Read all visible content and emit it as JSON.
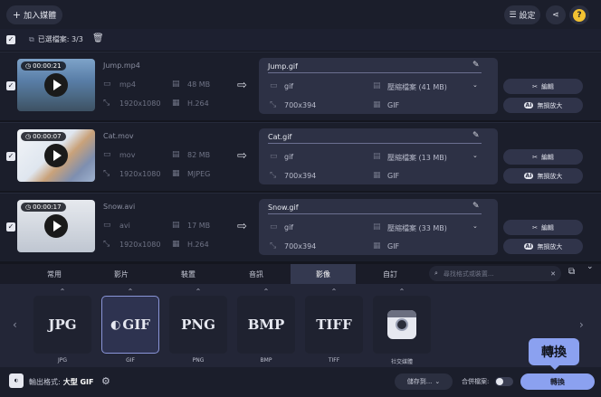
{
  "topbar": {
    "add_media_label": "加入媒體",
    "settings_label": "設定",
    "help_label": "?"
  },
  "selection": {
    "count_label": "已選檔案: 3/3"
  },
  "files": [
    {
      "duration": "00:00:21",
      "source": {
        "name": "Jump.mp4",
        "ext": "mp4",
        "size": "48 MB",
        "resolution": "1920x1080",
        "codec": "H.264"
      },
      "target": {
        "name": "Jump.gif",
        "ext": "gif",
        "compress": "壓縮檔案 (41 MB)",
        "resolution": "700x394",
        "codec": "GIF"
      }
    },
    {
      "duration": "00:00:07",
      "source": {
        "name": "Cat.mov",
        "ext": "mov",
        "size": "82 MB",
        "resolution": "1920x1080",
        "codec": "MJPEG"
      },
      "target": {
        "name": "Cat.gif",
        "ext": "gif",
        "compress": "壓縮檔案 (13 MB)",
        "resolution": "700x394",
        "codec": "GIF"
      }
    },
    {
      "duration": "00:00:17",
      "source": {
        "name": "Snow.avi",
        "ext": "avi",
        "size": "17 MB",
        "resolution": "1920x1080",
        "codec": "H.264"
      },
      "target": {
        "name": "Snow.gif",
        "ext": "gif",
        "compress": "壓縮檔案 (33 MB)",
        "resolution": "700x394",
        "codec": "GIF"
      }
    }
  ],
  "row_actions": {
    "edit_label": "編輯",
    "upscale_label": "無損放大",
    "ai_badge": "AI"
  },
  "tabs": [
    "常用",
    "影片",
    "裝置",
    "音訊",
    "影像",
    "自訂"
  ],
  "active_tab": "影像",
  "search": {
    "placeholder": "尋找格式或裝置..."
  },
  "formats": [
    {
      "logo": "JPG",
      "label": "JPG"
    },
    {
      "logo": "GIF",
      "label": "GIF"
    },
    {
      "logo": "PNG",
      "label": "PNG"
    },
    {
      "logo": "BMP",
      "label": "BMP"
    },
    {
      "logo": "TIFF",
      "label": "TIFF"
    },
    {
      "logo": "",
      "label": "社交媒體"
    }
  ],
  "bottom": {
    "output_prefix": "輸出格式:",
    "output_format": "大型 GIF",
    "save_to_label": "儲存到...",
    "merge_label": "合併檔案:",
    "convert_label": "轉換",
    "tooltip": "轉換"
  },
  "colors": {
    "accent": "#8ba1f0",
    "background": "#14161f",
    "panel": "#2d3145"
  }
}
